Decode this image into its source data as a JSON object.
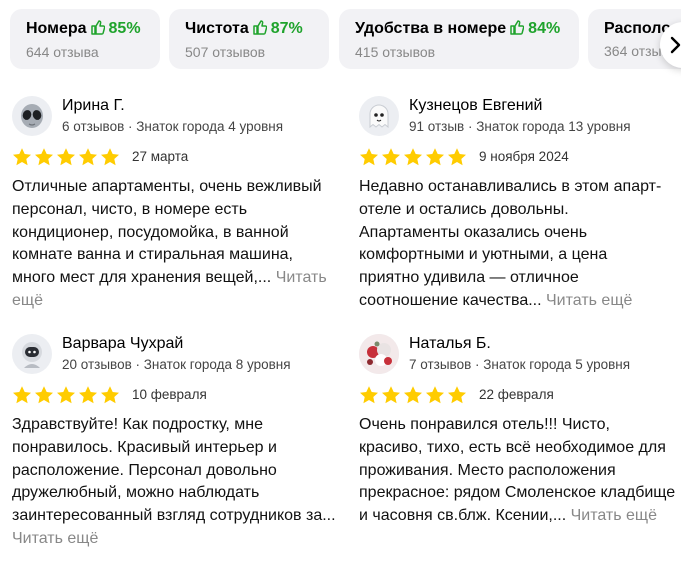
{
  "aspects": [
    {
      "title": "Номера",
      "percent": "85%",
      "count": "644 отзыва"
    },
    {
      "title": "Чистота",
      "percent": "87%",
      "count": "507 отзывов"
    },
    {
      "title": "Удобства в номере",
      "percent": "84%",
      "count": "415 отзывов"
    },
    {
      "title": "Располо",
      "percent": "",
      "count": "364 отзыва"
    }
  ],
  "colors": {
    "percent": "#1fa32c",
    "star": "#fc0",
    "chip_bg": "#f2f2f5",
    "muted": "#888888"
  },
  "scroll_icon": "chevron-right-icon",
  "reviews": [
    {
      "author": "Ирина Г.",
      "meta": "6 отзывов · Знаток города 4 уровня",
      "rating": 5,
      "date": "27 марта",
      "avatar": "alien-icon",
      "text": "Отличные апартаменты, очень вежливый персонал, чисто, в номере есть кондиционер, посудомойка, в ванной комнате ванна и стиральная машина, много мест для хранения вещей,...",
      "more": "Читать ещё"
    },
    {
      "author": "Кузнецов Евгений",
      "meta": "91 отзыв · Знаток города 13 уровня",
      "rating": 5,
      "date": "9 ноября 2024",
      "avatar": "ghost-icon",
      "text": "Недавно останавливались в этом апарт-отеле и остались довольны. Апартаменты оказались очень комфортными и уютными, а цена приятно удивила — отличное соотношение качества...",
      "more": "Читать ещё"
    },
    {
      "author": "Варвара Чухрай",
      "meta": "20 отзывов · Знаток города 8 уровня",
      "rating": 5,
      "date": "10 февраля",
      "avatar": "astronaut-icon",
      "text": "Здравствуйте! Как подростку, мне понравилось. Красивый интерьер и расположение. Персонал довольно дружелюбный, можно наблюдать заинтересованный взгляд сотрудников за...",
      "more": "Читать ещё"
    },
    {
      "author": "Наталья Б.",
      "meta": "7 отзывов · Знаток города 5 уровня",
      "rating": 5,
      "date": "22 февраля",
      "avatar": "photo-avatar",
      "text": "Очень понравился отель!!! Чисто, красиво, тихо, есть всё необходимое для проживания. Место расположения прекрасное: рядом Смоленское кладбище и часовня св.блж. Ксении,...",
      "more": "Читать ещё"
    }
  ]
}
